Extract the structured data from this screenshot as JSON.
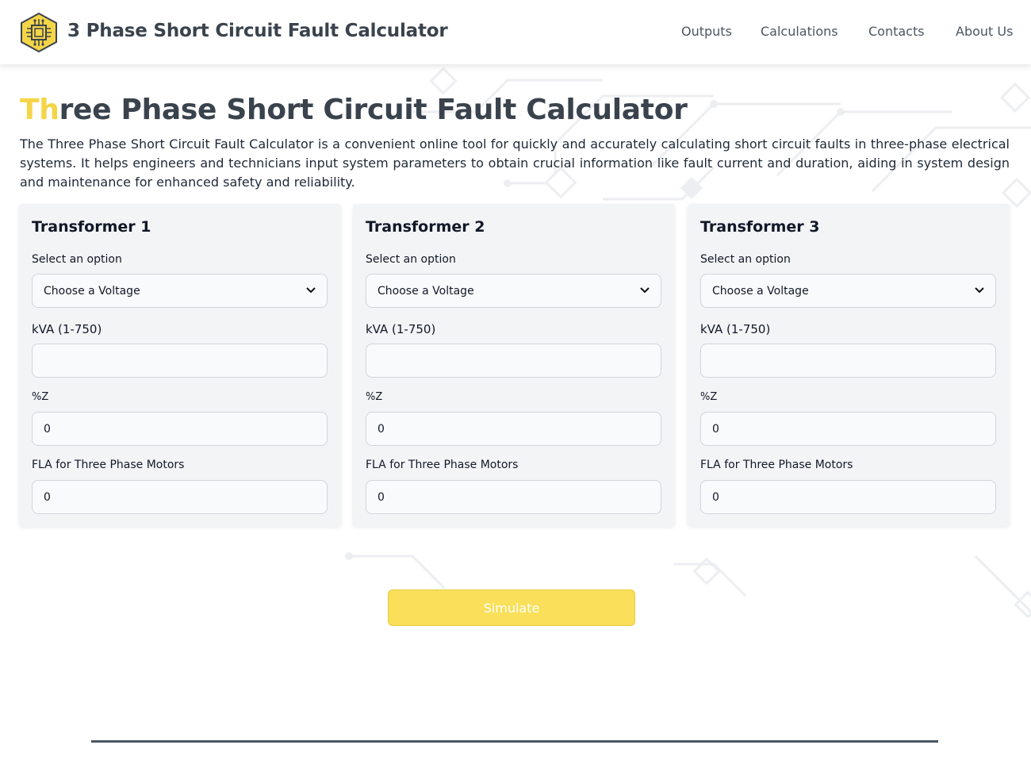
{
  "header": {
    "brand": "3 Phase Short Circuit Fault Calculator",
    "logo_icon": "circuit-chip-icon",
    "nav": [
      "Outputs",
      "Calculations",
      "Contacts",
      "About Us"
    ]
  },
  "main": {
    "title_highlight": "Th",
    "title_rest": "ree Phase Short Circuit Fault Calculator",
    "description": "The Three Phase Short Circuit Fault Calculator is a convenient online tool for quickly and accurately calculating short circuit faults in three-phase electrical systems. It helps engineers and technicians input system parameters to obtain crucial information like fault current and duration, aiding in system design and maintenance for enhanced safety and reliability.",
    "transformers": [
      {
        "title": "Transformer 1",
        "select_label": "Select an option",
        "select_value": "Choose a Voltage",
        "kva_label": "kVA (1-750)",
        "kva_value": "",
        "z_label": "%Z",
        "z_value": "0",
        "fla_label": "FLA for Three Phase Motors",
        "fla_value": "0"
      },
      {
        "title": "Transformer 2",
        "select_label": "Select an option",
        "select_value": "Choose a Voltage",
        "kva_label": "kVA (1-750)",
        "kva_value": "",
        "z_label": "%Z",
        "z_value": "0",
        "fla_label": "FLA for Three Phase Motors",
        "fla_value": "0"
      },
      {
        "title": "Transformer 3",
        "select_label": "Select an option",
        "select_value": "Choose a Voltage",
        "kva_label": "kVA (1-750)",
        "kva_value": "",
        "z_label": "%Z",
        "z_value": "0",
        "fla_label": "FLA for Three Phase Motors",
        "fla_value": "0"
      }
    ],
    "simulate_label": "Simulate"
  },
  "colors": {
    "accent": "#f5d547",
    "button": "#f9df5a",
    "heading": "#3a434d",
    "card_bg": "#f3f4f6"
  }
}
